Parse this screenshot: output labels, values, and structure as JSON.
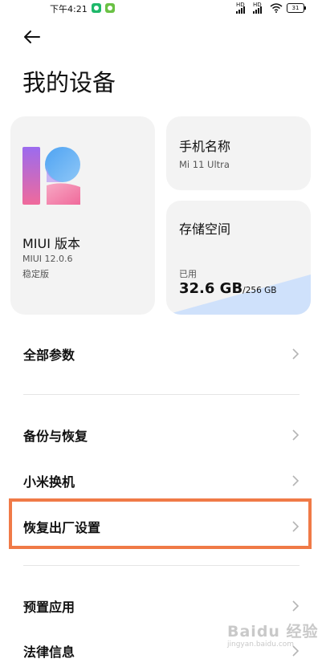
{
  "status_bar": {
    "time": "下午4:21",
    "battery": "31",
    "signal_1_label": "HD",
    "signal_2_label": "HD",
    "icons": [
      "notification-app-icon",
      "download-icon",
      "signal-icon",
      "signal-icon",
      "wifi-icon",
      "battery-icon"
    ]
  },
  "header": {
    "back_icon": "back-arrow-icon",
    "title": "我的设备"
  },
  "miui_card": {
    "title": "MIUI 版本",
    "version": "MIUI 12.0.6",
    "channel": "稳定版",
    "logo_colors": [
      "#f06a9b",
      "#9b6bef",
      "#4ea3f2"
    ]
  },
  "device_name_card": {
    "label": "手机名称",
    "value": "Mi 11 Ultra"
  },
  "storage_card": {
    "label": "存储空间",
    "used_label": "已用",
    "used": "32.6 GB",
    "total": "/256 GB",
    "used_fraction": 0.127,
    "fill_color": "#cfe1fb"
  },
  "menu_items": [
    {
      "label": "全部参数"
    },
    {
      "label": "备份与恢复"
    },
    {
      "label": "小米换机"
    },
    {
      "label": "恢复出厂设置"
    },
    {
      "label": "预置应用"
    },
    {
      "label": "法律信息"
    }
  ],
  "highlight_color": "#f07a47",
  "watermark": {
    "main": "Baidu 经验",
    "sub": "jingyan.baidu.com"
  }
}
